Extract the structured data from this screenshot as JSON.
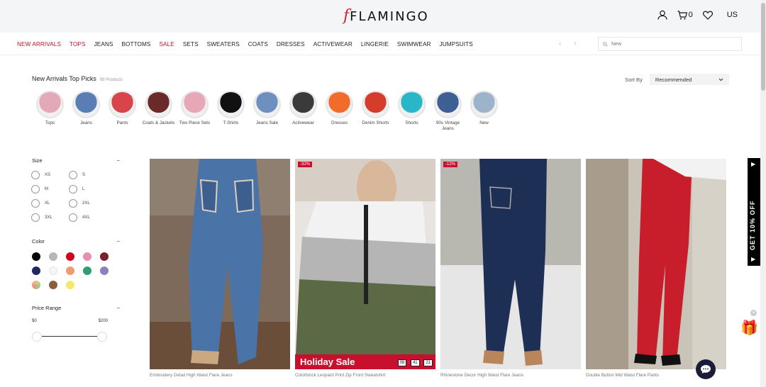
{
  "header": {
    "logo_letter": "f",
    "logo_text": "FLAMINGO",
    "cart_count": "0",
    "region": "US"
  },
  "nav": {
    "items": [
      {
        "label": "NEW ARRIVALS",
        "highlight": true
      },
      {
        "label": "TOPS",
        "highlight": true
      },
      {
        "label": "JEANS",
        "highlight": false
      },
      {
        "label": "BOTTOMS",
        "highlight": false
      },
      {
        "label": "SALE",
        "highlight": true
      },
      {
        "label": "SETS",
        "highlight": false
      },
      {
        "label": "SWEATERS",
        "highlight": false
      },
      {
        "label": "COATS",
        "highlight": false
      },
      {
        "label": "DRESSES",
        "highlight": false
      },
      {
        "label": "ACTIVEWEAR",
        "highlight": false
      },
      {
        "label": "LINGERIE",
        "highlight": false
      },
      {
        "label": "SWIMWEAR",
        "highlight": false
      },
      {
        "label": "JUMPSUITS",
        "highlight": false
      }
    ],
    "prev": "‹",
    "next": "›"
  },
  "search": {
    "placeholder": "New"
  },
  "listing": {
    "title": "New Arrivals Top Picks",
    "count": "99 Products",
    "sort_label": "Sort By",
    "sort_value": "Recommended"
  },
  "categories": [
    {
      "label": "Tops",
      "icon": "tops-thumb"
    },
    {
      "label": "Jeans",
      "icon": "jeans-thumb"
    },
    {
      "label": "Pants",
      "icon": "pants-thumb"
    },
    {
      "label": "Coats & Jackets",
      "icon": "coats-thumb"
    },
    {
      "label": "Two Piece Sets",
      "icon": "sets-thumb"
    },
    {
      "label": "T-Shirts",
      "icon": "tshirts-thumb"
    },
    {
      "label": "Jeans Sale",
      "icon": "jeans-sale-thumb"
    },
    {
      "label": "Activewear",
      "icon": "activewear-thumb"
    },
    {
      "label": "Dresses",
      "icon": "dresses-thumb"
    },
    {
      "label": "Denim Shorts",
      "icon": "denim-shorts-thumb"
    },
    {
      "label": "Shorts",
      "icon": "shorts-thumb"
    },
    {
      "label": "90s Vintage Jeans",
      "icon": "vintage-jeans-thumb"
    },
    {
      "label": "New",
      "icon": "new-thumb"
    }
  ],
  "filters": {
    "size": {
      "title": "Size",
      "toggle": "−",
      "options": [
        "XS",
        "S",
        "M",
        "L",
        "XL",
        "2XL",
        "3XL",
        "4XL"
      ]
    },
    "color": {
      "title": "Color",
      "toggle": "−",
      "swatches": [
        "#000000",
        "#b7b7b7",
        "#d0021b",
        "#e88fb0",
        "#7b1d2a",
        "#1f2a5c",
        "#f5f5f5",
        "#f39a6b",
        "#2e9e73",
        "#8e7fbf",
        "multicolor",
        "#8b5e3c",
        "#f4e872"
      ]
    },
    "price": {
      "title": "Price Range",
      "toggle": "−",
      "min": "$0",
      "max": "$200"
    }
  },
  "products": [
    {
      "name": "Embroidery Detail High Waist Flare Jeans",
      "discount": "",
      "holiday": ""
    },
    {
      "name": "Colorblock Leopard Print Zip Front Sweatshirt",
      "discount": "-32%",
      "holiday": "Holiday Sale",
      "timer": [
        "08",
        "41",
        "21"
      ]
    },
    {
      "name": "Rhinestone Decor High Waist Flare Jeans",
      "discount": "-12%",
      "holiday": ""
    },
    {
      "name": "Double Button Mid Waist Flare Pants",
      "discount": "",
      "holiday": ""
    }
  ],
  "promo": {
    "text": "GET 10% OFF"
  }
}
